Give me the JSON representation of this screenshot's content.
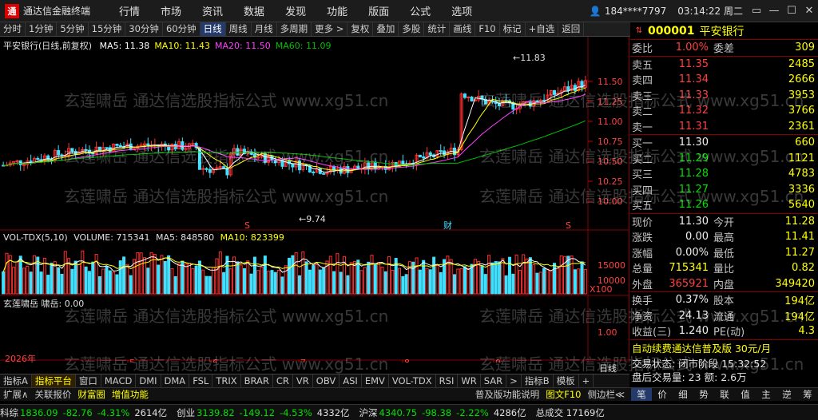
{
  "title_bar": {
    "app_title": "通达信金融终端",
    "menus": [
      "行情",
      "市场",
      "资讯",
      "数据",
      "发现",
      "功能",
      "版面",
      "公式",
      "选项"
    ],
    "user": "184****7797",
    "time": "03:14:22 周二",
    "win_controls": [
      "▭",
      "—",
      "☐",
      "✕"
    ]
  },
  "toolbar": {
    "items": [
      "分时",
      "1分钟",
      "5分钟",
      "15分钟",
      "30分钟",
      "60分钟",
      "日线",
      "周线",
      "月线",
      "多周期",
      "更多 >",
      "复权",
      "叠加",
      "多股",
      "统计",
      "画线",
      "F10",
      "标记",
      "+自选",
      "返回"
    ],
    "active": "日线"
  },
  "main_chart": {
    "legend_title": "平安银行(日线,前复权)",
    "ma_labels": [
      {
        "text": "MA5: 11.38",
        "color": "#ffffff"
      },
      {
        "text": "MA10: 11.43",
        "color": "#ffff00"
      },
      {
        "text": "MA20: 11.50",
        "color": "#ff40ff"
      },
      {
        "text": "MA60: 11.09",
        "color": "#00c000"
      }
    ],
    "y_ticks": [
      "11.50",
      "11.25",
      "11.00",
      "10.75",
      "10.50",
      "10.25",
      "10.00"
    ],
    "high_label": "11.83",
    "low_label": "9.74",
    "event_markers": [
      "S",
      "财",
      "S"
    ],
    "vol_legend": {
      "name": "VOL-TDX(5,10)",
      "volume": "VOLUME: 715341",
      "ma5": "MA5: 848580",
      "ma10": "MA10: 823399"
    },
    "vol_ticks": [
      "15000",
      "10000",
      "X100"
    ],
    "ind_legend": "玄莲啸岳  啸岳: 0.00",
    "ind_ticks": [
      "1.00"
    ],
    "x_labels": [
      "2026年",
      "5",
      "6",
      "7",
      "8",
      "9"
    ],
    "period_tag": "日线"
  },
  "quote_panel": {
    "code": "000001",
    "name": "平安银行",
    "ratio_label": "委比",
    "ratio_value": "1.00%",
    "diff_label": "委差",
    "diff_value": "309",
    "asks": [
      {
        "label": "卖五",
        "price": "11.35",
        "vol": "2485"
      },
      {
        "label": "卖四",
        "price": "11.34",
        "vol": "2666"
      },
      {
        "label": "卖三",
        "price": "11.33",
        "vol": "3953"
      },
      {
        "label": "卖二",
        "price": "11.32",
        "vol": "3766"
      },
      {
        "label": "卖一",
        "price": "11.31",
        "vol": "2361"
      }
    ],
    "bids": [
      {
        "label": "买一",
        "price": "11.30",
        "vol": "660"
      },
      {
        "label": "买二",
        "price": "11.29",
        "vol": "1121"
      },
      {
        "label": "买三",
        "price": "11.28",
        "vol": "4783"
      },
      {
        "label": "买四",
        "price": "11.27",
        "vol": "3336"
      },
      {
        "label": "买五",
        "price": "11.26",
        "vol": "5640"
      }
    ],
    "stats": [
      {
        "l1": "现价",
        "v1": "11.30",
        "c1": "white",
        "l2": "今开",
        "v2": "11.28",
        "c2": "green"
      },
      {
        "l1": "涨跌",
        "v1": "0.00",
        "c1": "white",
        "l2": "最高",
        "v2": "11.41",
        "c2": "red"
      },
      {
        "l1": "涨幅",
        "v1": "0.00%",
        "c1": "white",
        "l2": "最低",
        "v2": "11.27",
        "c2": "green"
      },
      {
        "l1": "总量",
        "v1": "715341",
        "c1": "yellow",
        "l2": "量比",
        "v2": "0.82",
        "c2": "green"
      },
      {
        "l1": "外盘",
        "v1": "365921",
        "c1": "red",
        "l2": "内盘",
        "v2": "349420",
        "c2": "green"
      }
    ],
    "stats2": [
      {
        "l1": "换手",
        "v1": "0.37%",
        "l2": "股本",
        "v2": "194亿"
      },
      {
        "l1": "净资",
        "v1": "24.13",
        "l2": "流通",
        "v2": "194亿"
      },
      {
        "l1": "收益(三)",
        "v1": "1.240",
        "l2": "PE(动)",
        "v2": "4.3"
      }
    ],
    "promo": "自动续费通达信普及版 30元/月",
    "trade_state": "交易状态: 闭市阶段  15:32:52",
    "after_hours": "盘后交易量: 23  额: 2.6万",
    "bottom_tabs": [
      "笔",
      "价",
      "细",
      "势",
      "联",
      "值",
      "主",
      "逆",
      "筹"
    ]
  },
  "bottom_tabs1": {
    "items": [
      "指标A",
      "指标平台",
      "窗口",
      "MACD",
      "DMI",
      "DMA",
      "FSL",
      "TRIX",
      "BRAR",
      "CR",
      "VR",
      "OBV",
      "ASI",
      "EMV",
      "VOL-TDX",
      "RSI",
      "WR",
      "SAR",
      ">",
      "指标B",
      "模板",
      "+"
    ],
    "active": "指标平台"
  },
  "bottom_tabs2": {
    "items": [
      "扩展∧",
      "关联报价",
      "财富圈",
      "增值功能"
    ],
    "right_items": [
      "普及版功能说明",
      "图文F10",
      "侧边栏≪"
    ]
  },
  "status_bar": {
    "items": [
      {
        "label": "科综",
        "value": "1836.09",
        "chg": "-82.76",
        "pct": "-4.31%",
        "amt": "2614亿"
      },
      {
        "label": "创业",
        "value": "3139.82",
        "chg": "-149.12",
        "pct": "-4.53%",
        "amt": "4332亿"
      },
      {
        "label": "沪深",
        "value": "4340.75",
        "chg": "-98.38",
        "pct": "-2.22%",
        "amt": "4286亿"
      }
    ],
    "tail": "总成交  17169亿"
  },
  "watermark": "玄莲啸岳 通达信选股指标公式 www.xg51.cn",
  "chart_data": {
    "type": "candlestick",
    "title": "平安银行(日线,前复权)",
    "ylim": [
      9.7,
      11.9
    ],
    "high": 11.83,
    "low": 9.74,
    "ma": {
      "MA5": 11.38,
      "MA10": 11.43,
      "MA20": 11.5,
      "MA60": 11.09
    },
    "volume": 715341
  },
  "colors": {
    "up": "#ff3030",
    "down": "#40e0ff",
    "accent": "#ffff00"
  }
}
